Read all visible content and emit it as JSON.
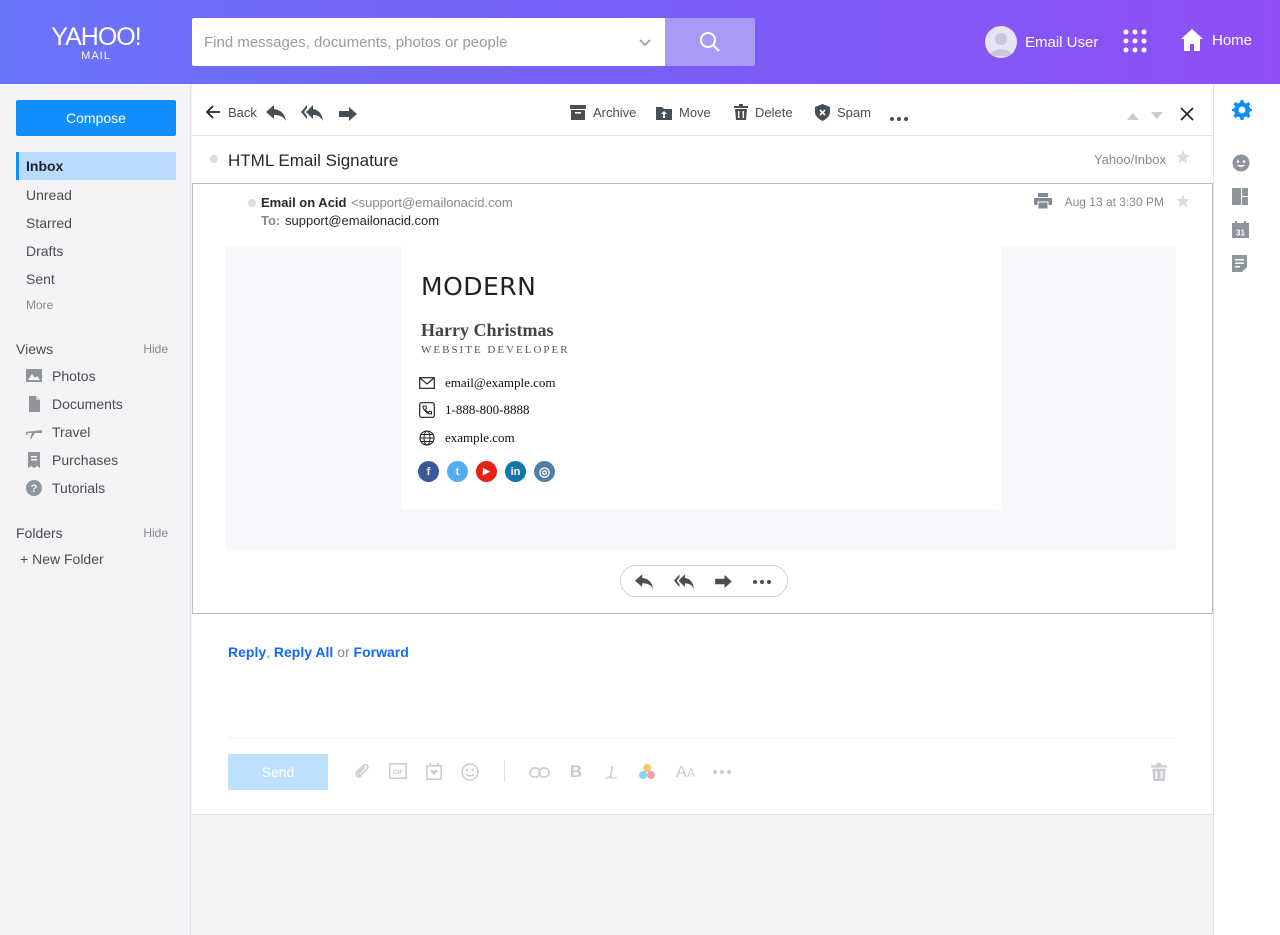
{
  "header": {
    "logo_line1": "YAHOO!",
    "logo_line2": "MAIL",
    "search_placeholder": "Find messages, documents, photos or people",
    "user_name": "Email User",
    "home_label": "Home"
  },
  "sidebar": {
    "compose_label": "Compose",
    "folders": [
      {
        "label": "Inbox",
        "active": true
      },
      {
        "label": "Unread"
      },
      {
        "label": "Starred"
      },
      {
        "label": "Drafts"
      },
      {
        "label": "Sent"
      }
    ],
    "more_label": "More",
    "views_title": "Views",
    "views_hide": "Hide",
    "views": [
      {
        "label": "Photos",
        "icon": "photo-icon"
      },
      {
        "label": "Documents",
        "icon": "document-icon"
      },
      {
        "label": "Travel",
        "icon": "airplane-icon"
      },
      {
        "label": "Purchases",
        "icon": "receipt-icon"
      },
      {
        "label": "Tutorials",
        "icon": "help-icon"
      }
    ],
    "folders_title": "Folders",
    "folders_hide": "Hide",
    "new_folder_label": "New Folder"
  },
  "toolbar": {
    "back_label": "Back",
    "archive_label": "Archive",
    "move_label": "Move",
    "delete_label": "Delete",
    "spam_label": "Spam"
  },
  "message": {
    "subject": "HTML Email Signature",
    "folder": "Yahoo/Inbox",
    "from_name": "Email on Acid",
    "from_address": "<support@emailonacid.com",
    "to_label": "To:",
    "to_address": "support@emailonacid.com",
    "date": "Aug 13 at 3:30 PM"
  },
  "signature": {
    "brand": "MODERN",
    "name": "Harry Christmas",
    "title": "WEBSITE DEVELOPER",
    "email": "email@example.com",
    "phone": "1-888-800-8888",
    "website": "example.com",
    "social": [
      {
        "name": "facebook-icon",
        "glyph": "f",
        "color": "#3b5998"
      },
      {
        "name": "twitter-icon",
        "glyph": "t",
        "color": "#55acee"
      },
      {
        "name": "youtube-icon",
        "glyph": "▶",
        "color": "#e62117"
      },
      {
        "name": "linkedin-icon",
        "glyph": "in",
        "color": "#0e76a8"
      },
      {
        "name": "instagram-icon",
        "glyph": "◎",
        "color": "#517fa4"
      }
    ]
  },
  "reply": {
    "reply": "Reply",
    "comma": ",",
    "reply_all": "Reply All",
    "or": "or",
    "forward": "Forward",
    "send_label": "Send"
  },
  "colors": {
    "accent": "#0f8efe",
    "header_start": "#6a74fb",
    "header_end": "#8f4ff5"
  }
}
